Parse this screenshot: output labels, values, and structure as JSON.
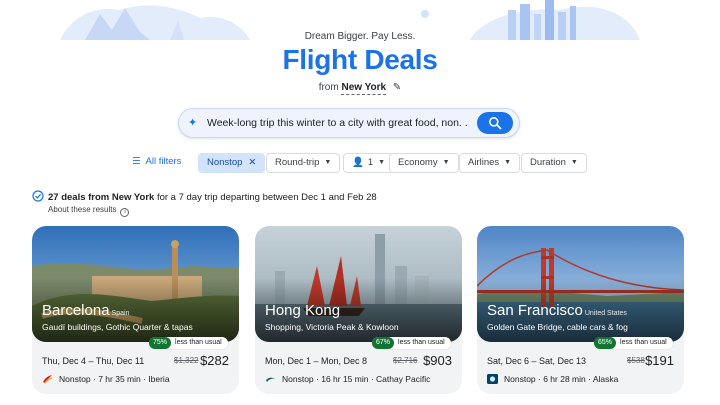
{
  "hero": {
    "tagline": "Dream Bigger. Pay Less.",
    "title": "Flight Deals",
    "origin_prefix": "from",
    "origin_city": "New York"
  },
  "search": {
    "query": "Week-long trip this winter to a city with great food, non. ."
  },
  "filters": {
    "all": "All filters",
    "nonstop": "Nonstop",
    "trip_type": "Round-trip",
    "passengers": "1",
    "cabin": "Economy",
    "airlines": "Airlines",
    "duration": "Duration"
  },
  "results": {
    "count_text": "27 deals from New York",
    "detail_text": "for a 7 day trip departing between Dec 1 and Feb 28",
    "about": "About these results"
  },
  "deals": [
    {
      "city": "Barcelona",
      "country": "Spain",
      "desc": "Gaudí buildings, Gothic Quarter & tapas",
      "pct": "75%",
      "badge_text": "less than usual",
      "dates": "Thu, Dec 4 – Thu, Dec 11",
      "old_price": "$1,322",
      "price": "$282",
      "flight": "Nonstop · 7 hr 35 min · Iberia",
      "airline_icon": "iberia-logo"
    },
    {
      "city": "Hong Kong",
      "country": "",
      "desc": "Shopping, Victoria Peak & Kowloon",
      "pct": "67%",
      "badge_text": "less than usual",
      "dates": "Mon, Dec 1 – Mon, Dec 8",
      "old_price": "$2,716",
      "price": "$903",
      "flight": "Nonstop · 16 hr 15 min · Cathay Pacific",
      "airline_icon": "cathay-pacific-logo"
    },
    {
      "city": "San Francisco",
      "country": "United States",
      "desc": "Golden Gate Bridge, cable cars & fog",
      "pct": "65%",
      "badge_text": "less than usual",
      "dates": "Sat, Dec 6 – Sat, Dec 13",
      "old_price": "$538",
      "price": "$191",
      "flight": "Nonstop · 6 hr 28 min · Alaska",
      "airline_icon": "alaska-logo"
    }
  ],
  "colors": {
    "accent": "#1a73e8",
    "badge_green": "#137333",
    "chip_selected": "#d2e3fc"
  }
}
